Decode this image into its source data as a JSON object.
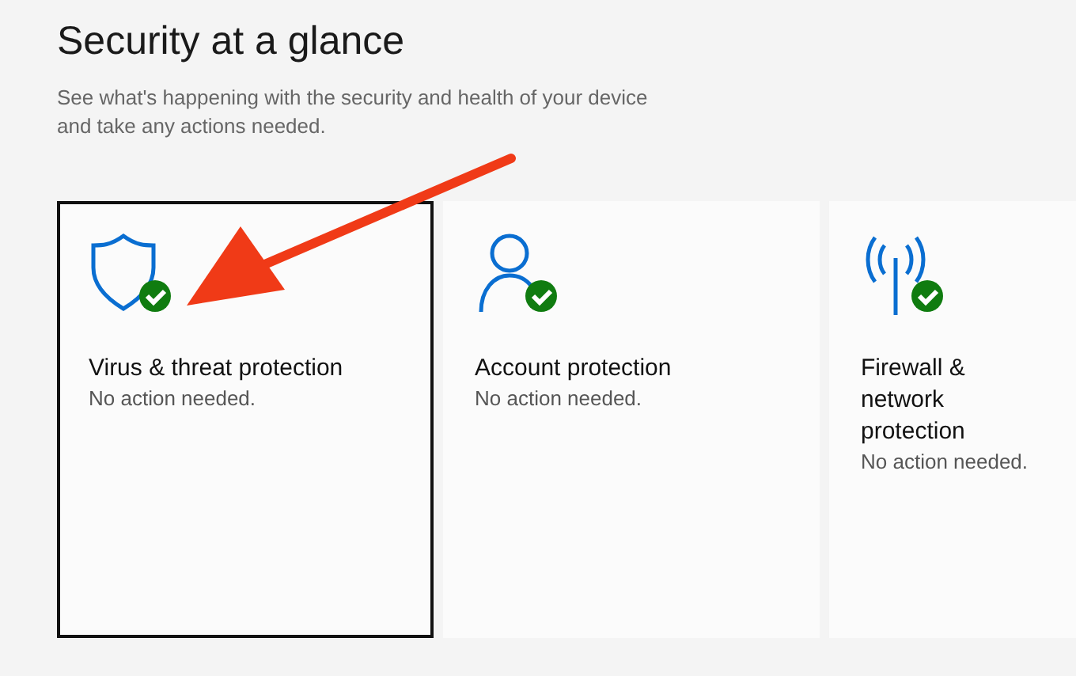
{
  "page": {
    "title": "Security at a glance",
    "description": "See what's happening with the security and health of your device and take any actions needed."
  },
  "tiles": [
    {
      "kind": "shield",
      "title": "Virus & threat protection",
      "status": "No action needed.",
      "selected": true
    },
    {
      "kind": "person",
      "title": "Account protection",
      "status": "No action needed.",
      "selected": false
    },
    {
      "kind": "antenna",
      "title": "Firewall & network protection",
      "status": "No action needed.",
      "selected": false
    }
  ]
}
